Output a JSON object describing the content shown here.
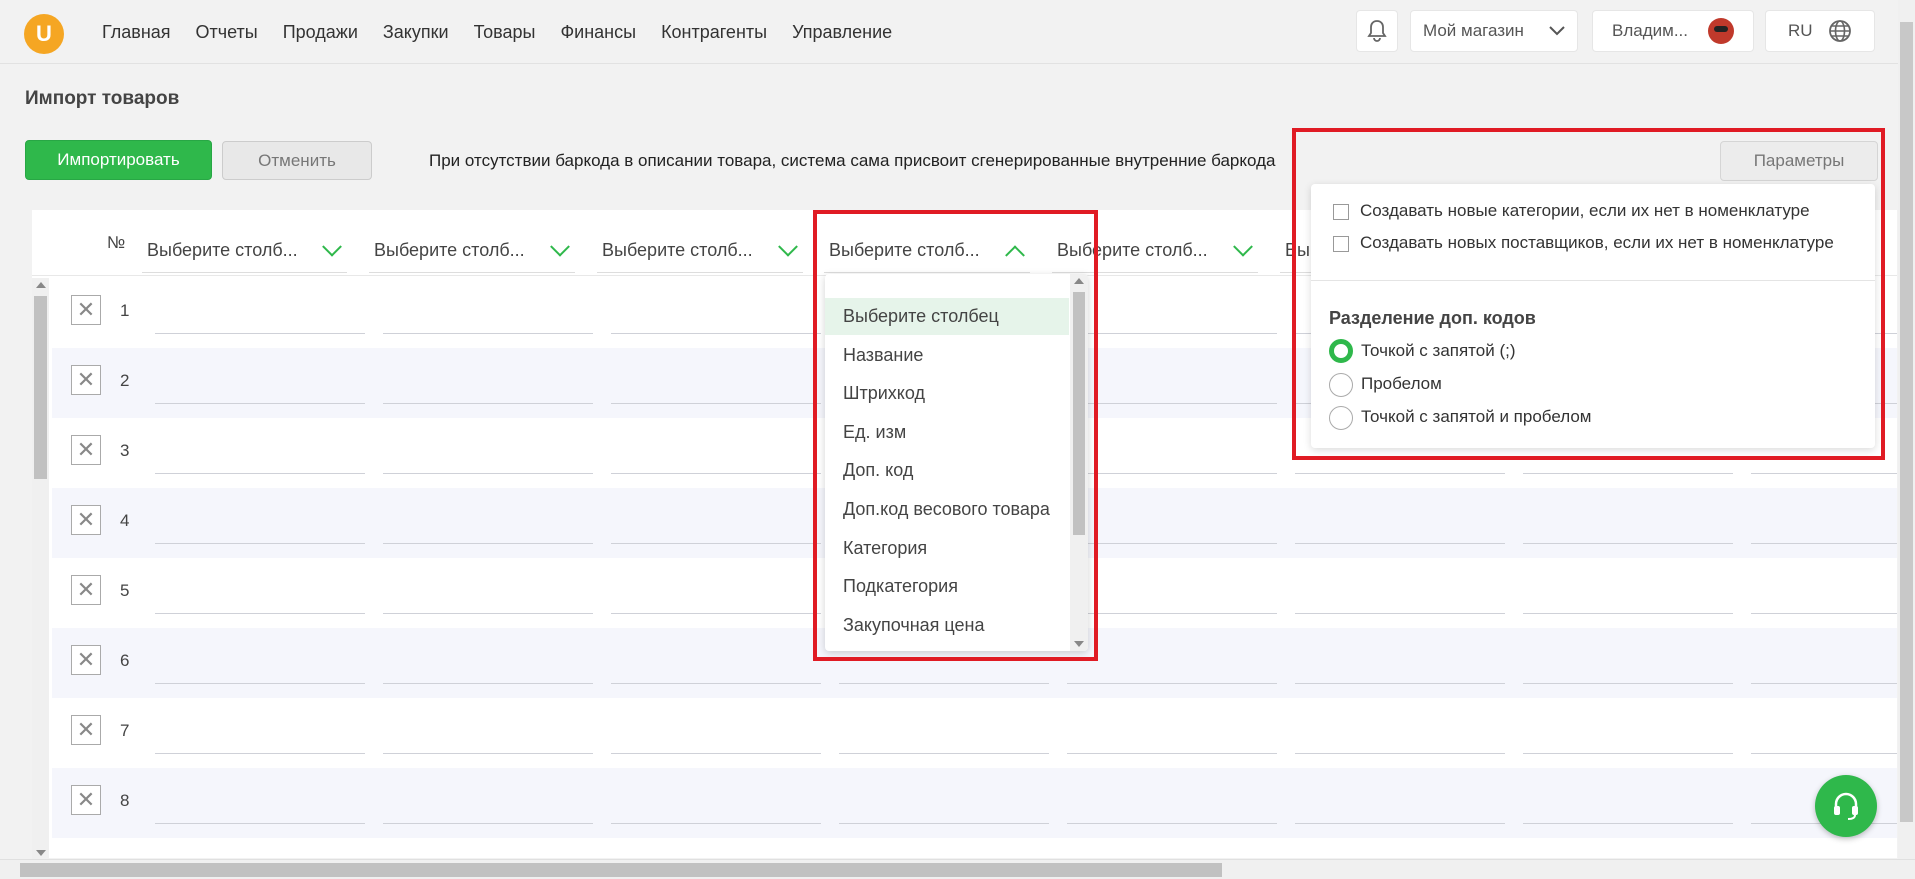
{
  "nav": {
    "logo_letter": "U",
    "items": [
      "Главная",
      "Отчеты",
      "Продажи",
      "Закупки",
      "Товары",
      "Финансы",
      "Контрагенты",
      "Управление"
    ]
  },
  "header": {
    "store": "Мой магазин",
    "user": "Владим...",
    "lang": "RU"
  },
  "page": {
    "title": "Импорт товаров",
    "import_button": "Импортировать",
    "cancel_button": "Отменить",
    "notice": "При отсутствии баркода в описании товара, система сама присвоит сгенерированные внутренние баркода",
    "params_button": "Параметры"
  },
  "table": {
    "num_header": "№",
    "column_placeholders": [
      "Выберите столб...",
      "Выберите столб...",
      "Выберите столб...",
      "Выберите столб...",
      "Выберите столб...",
      "Вы"
    ],
    "rows": [
      "1",
      "2",
      "3",
      "4",
      "5",
      "6",
      "7",
      "8"
    ]
  },
  "column_dropdown": {
    "open_column_index": 4,
    "options": [
      "Выберите столбец",
      "Название",
      "Штрихкод",
      "Ед. изм",
      "Доп. код",
      "Доп.код весового товара",
      "Категория",
      "Подкатегория",
      "Закупочная цена"
    ],
    "selected": "Выберите столбец"
  },
  "params": {
    "checkbox1": "Создавать новые категории, если их нет в номенклатуре",
    "checkbox2": "Создавать новых поставщиков, если их нет в номенклатуре",
    "section_title": "Разделение доп. кодов",
    "radio1": "Точкой с запятой (;)",
    "radio2": "Пробелом",
    "radio3": "Точкой с запятой и пробелом",
    "selected_radio": "Точкой с запятой (;)"
  },
  "colors": {
    "accent": "#2fb84b",
    "highlight": "#e01b24",
    "logo": "#f5a623"
  }
}
